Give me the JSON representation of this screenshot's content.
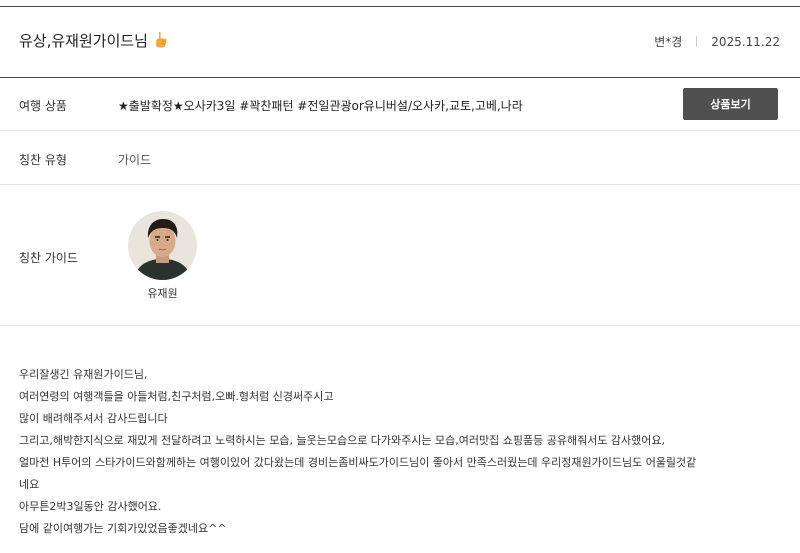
{
  "review": {
    "title": "유상,유재원가이드님",
    "title_icon": "thumbs-up-icon",
    "author": "변*경",
    "date": "2025.11.22"
  },
  "product": {
    "label": "여행 상품",
    "value": "★출발확정★오사카3일 #꽉찬패턴 #전일관광or유니버설/오사카,교토,고베,나라",
    "button_label": "상품보기"
  },
  "praise_type": {
    "label": "칭찬 유형",
    "value": "가이드"
  },
  "praise_guide": {
    "label": "칭찬 가이드",
    "guide_name": "유재원"
  },
  "body_lines": [
    "우리잘생긴 유재원가이드님,",
    "여러연령의 여행객들을 아들처럼,친구처럼,오빠.형처럼 신경써주시고",
    "많이 배려해주셔서 감사드립니다",
    "그리고,해박한지식으로 재밌게 전달하려고 노력하시는 모습, 늘웃는모습으로 다가와주시는 모습,여러맛집 쇼핑품등 공유해줘서도 감사했어요,",
    "얼마전 H투어의 스타가이드와함께하는 여행이있어 갔다왔는데 경비는좀비싸도가이드님이 좋아서 만족스러웠는데 우리정재원가이드님도 어울릴것같",
    "네요",
    "아무튼2박3일동안 감사했어요.",
    "담에 같이여행가는 기회가있었음좋겠네요^^"
  ],
  "colors": {
    "header_rule": "#444444",
    "row_divider": "#e4e4e4",
    "button_bg": "#505050",
    "thumb_icon": "#f2a73b"
  }
}
